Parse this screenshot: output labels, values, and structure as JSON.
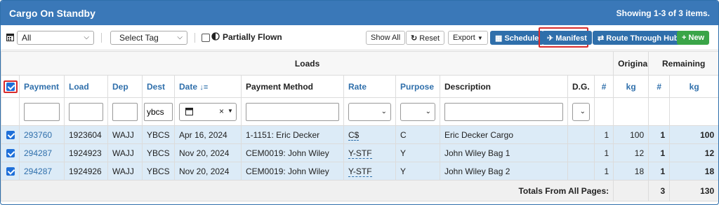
{
  "panel": {
    "title": "Cargo On Standby",
    "summary": "Showing 1-3 of 3 items."
  },
  "toolbar": {
    "status_select": "All",
    "tag_select": "Select Tag",
    "partially_flown_label": "Partially Flown",
    "show_all": "Show All",
    "reset": "Reset",
    "export": "Export",
    "schedule": "Schedule",
    "manifest": "Manifest",
    "route_through_hub": "Route Through Hub",
    "new": "New"
  },
  "grid": {
    "groups": {
      "loads": "Loads",
      "original": "Original",
      "remaining": "Remaining"
    },
    "columns": {
      "payment": "Payment",
      "load": "Load",
      "dep": "Dep",
      "dest": "Dest",
      "date": "Date",
      "payment_method": "Payment Method",
      "rate": "Rate",
      "purpose": "Purpose",
      "description": "Description",
      "dg": "D.G.",
      "orig_count": "#",
      "orig_kg": "kg",
      "rem_count": "#",
      "rem_kg": "kg"
    },
    "filters": {
      "dest_value": "ybcs"
    },
    "rows": [
      {
        "payment": "293760",
        "load": "1923604",
        "dep": "WAJJ",
        "dest": "YBCS",
        "date": "Apr 16, 2024",
        "payment_method": "1-1151: Eric Decker",
        "rate": "C$",
        "purpose": "C",
        "description": "Eric Decker Cargo",
        "dg": "",
        "orig_count": "1",
        "orig_kg": "100",
        "rem_count": "1",
        "rem_kg": "100"
      },
      {
        "payment": "294287",
        "load": "1924923",
        "dep": "WAJJ",
        "dest": "YBCS",
        "date": "Nov 20, 2024",
        "payment_method": "CEM0019: John Wiley",
        "rate": "Y-STF",
        "purpose": "Y",
        "description": "John Wiley Bag 1",
        "dg": "",
        "orig_count": "1",
        "orig_kg": "12",
        "rem_count": "1",
        "rem_kg": "12"
      },
      {
        "payment": "294287",
        "load": "1924926",
        "dep": "WAJJ",
        "dest": "YBCS",
        "date": "Nov 20, 2024",
        "payment_method": "CEM0019: John Wiley",
        "rate": "Y-STF",
        "purpose": "Y",
        "description": "John Wiley Bag 2",
        "dg": "",
        "orig_count": "1",
        "orig_kg": "18",
        "rem_count": "1",
        "rem_kg": "18"
      }
    ],
    "totals": {
      "label": "Totals From All Pages:",
      "rem_count": "3",
      "rem_kg": "130"
    }
  },
  "colors": {
    "header_blue": "#3a78b8",
    "row_blue": "#dcebf7",
    "highlight_red": "#d92b2b",
    "new_green": "#3aa548"
  }
}
